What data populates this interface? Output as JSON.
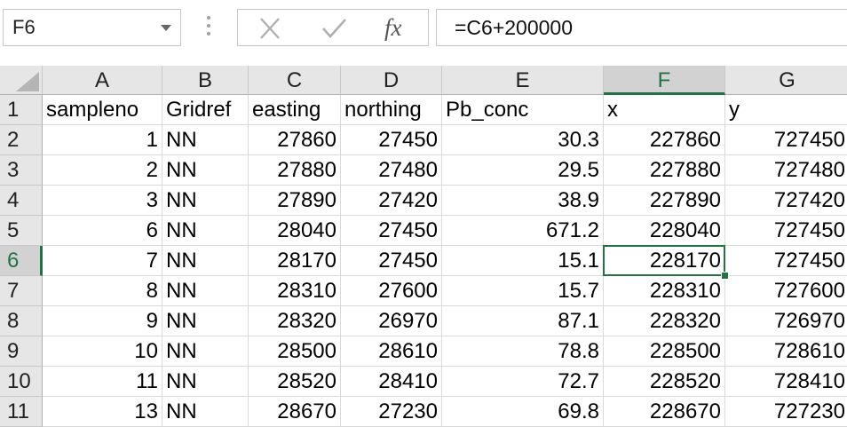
{
  "namebox": {
    "value": "F6",
    "dropdown_icon": "chevron-down-icon"
  },
  "formula_bar": {
    "cancel_icon": "close-icon",
    "enter_icon": "check-icon",
    "fx_label": "fx",
    "formula": "=C6+200000"
  },
  "active_cell": {
    "column": "F",
    "row": "6"
  },
  "columns": [
    "A",
    "B",
    "C",
    "D",
    "E",
    "F",
    "G"
  ],
  "rows": [
    {
      "num": "1",
      "cells": [
        "sampleno",
        "Gridref",
        "easting",
        "northing",
        "Pb_conc",
        "x",
        "y"
      ]
    },
    {
      "num": "2",
      "cells": [
        "1",
        "NN",
        "27860",
        "27450",
        "30.3",
        "227860",
        "727450"
      ]
    },
    {
      "num": "3",
      "cells": [
        "2",
        "NN",
        "27880",
        "27480",
        "29.5",
        "227880",
        "727480"
      ]
    },
    {
      "num": "4",
      "cells": [
        "3",
        "NN",
        "27890",
        "27420",
        "38.9",
        "227890",
        "727420"
      ]
    },
    {
      "num": "5",
      "cells": [
        "6",
        "NN",
        "28040",
        "27450",
        "671.2",
        "228040",
        "727450"
      ]
    },
    {
      "num": "6",
      "cells": [
        "7",
        "NN",
        "28170",
        "27450",
        "15.1",
        "228170",
        "727450"
      ]
    },
    {
      "num": "7",
      "cells": [
        "8",
        "NN",
        "28310",
        "27600",
        "15.7",
        "228310",
        "727600"
      ]
    },
    {
      "num": "8",
      "cells": [
        "9",
        "NN",
        "28320",
        "26970",
        "87.1",
        "228320",
        "726970"
      ]
    },
    {
      "num": "9",
      "cells": [
        "10",
        "NN",
        "28500",
        "28610",
        "78.8",
        "228500",
        "728610"
      ]
    },
    {
      "num": "10",
      "cells": [
        "11",
        "NN",
        "28520",
        "28410",
        "72.7",
        "228520",
        "728410"
      ]
    },
    {
      "num": "11",
      "cells": [
        "13",
        "NN",
        "28670",
        "27230",
        "69.8",
        "228670",
        "727230"
      ]
    }
  ],
  "colors": {
    "accent": "#217346",
    "header_bg": "#e6e6e6",
    "header_active_bg": "#d2d2d2",
    "gridline": "#d9d9d9"
  }
}
